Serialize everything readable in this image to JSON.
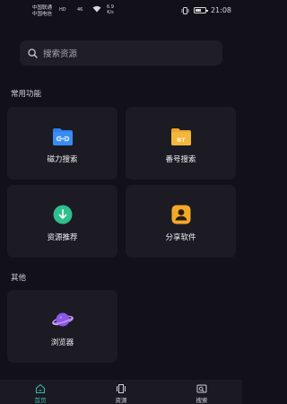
{
  "status_bar": {
    "carrier_1": "中国联通",
    "carrier_2": "中国电信",
    "signal_1": "HD",
    "signal_2": "46",
    "speed_value": "6.9",
    "speed_unit": "K/s",
    "time": "21:08"
  },
  "search": {
    "placeholder": "搜索资源"
  },
  "sections": {
    "common": "常用功能",
    "other": "其他"
  },
  "cards": {
    "magnet_search": "磁力搜索",
    "number_search": "番号搜索",
    "resource_recommend": "资源推荐",
    "share_software": "分享软件",
    "browser": "浏览器"
  },
  "icons": {
    "number_badge": "BT"
  },
  "bottom_nav": {
    "home": "首页",
    "resources": "资源",
    "search": "搜索"
  },
  "colors": {
    "background": "#12111a",
    "card": "#1c1b24",
    "accent_teal": "#39b9b0",
    "magnet_blue": "#2f7ff0",
    "folder_yellow": "#f4b63b",
    "recommend_green": "#2fbf8c",
    "share_orange": "#f2a92a",
    "browser_purple": "#8b58e6"
  }
}
